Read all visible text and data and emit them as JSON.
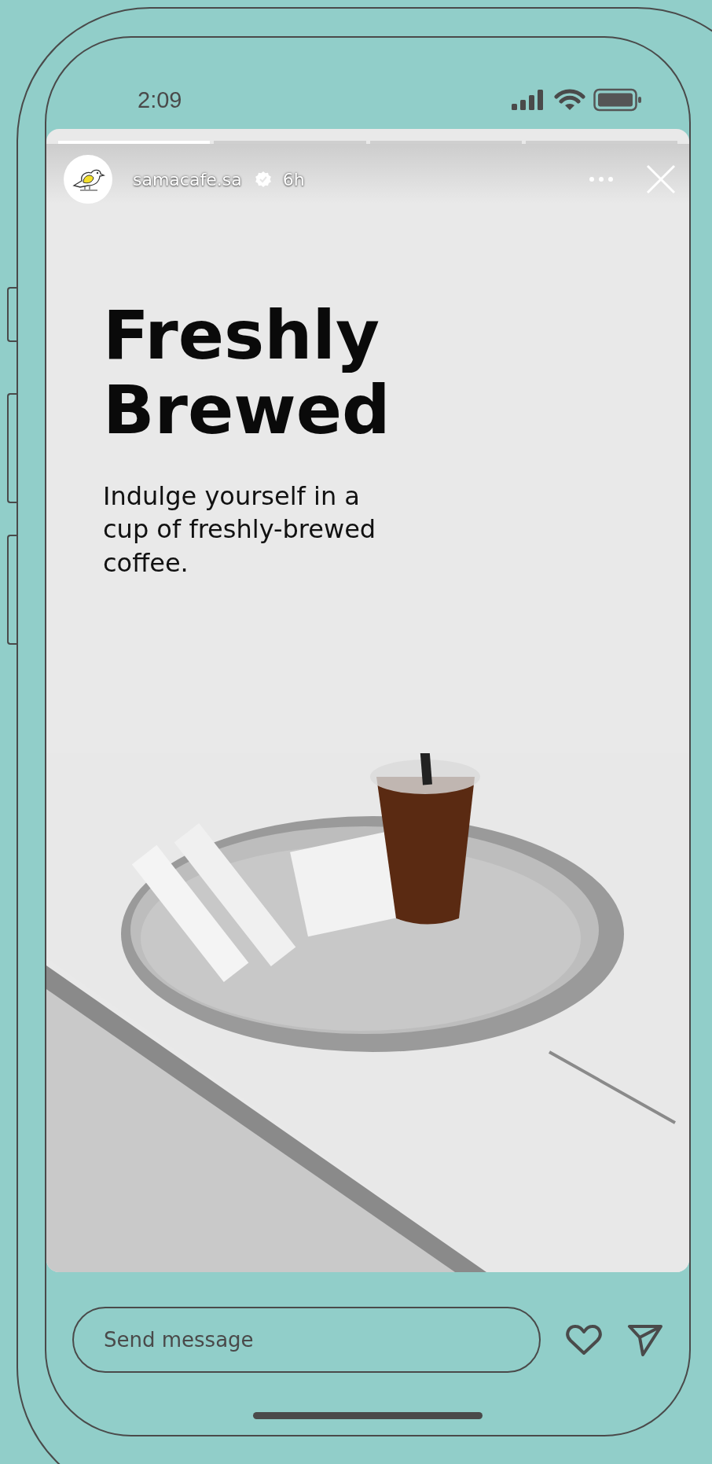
{
  "status_bar": {
    "time": "2:09"
  },
  "story": {
    "progress": [
      {
        "seen": true
      },
      {
        "seen": false
      },
      {
        "seen": false
      },
      {
        "seen": false
      }
    ],
    "username": "samacafe.sa",
    "verified": true,
    "age": "6h",
    "headline": "Freshly Brewed",
    "subtitle": "Indulge yourself in a cup of freshly-brewed coffee."
  },
  "reply_bar": {
    "placeholder": "Send message",
    "liked": false
  }
}
